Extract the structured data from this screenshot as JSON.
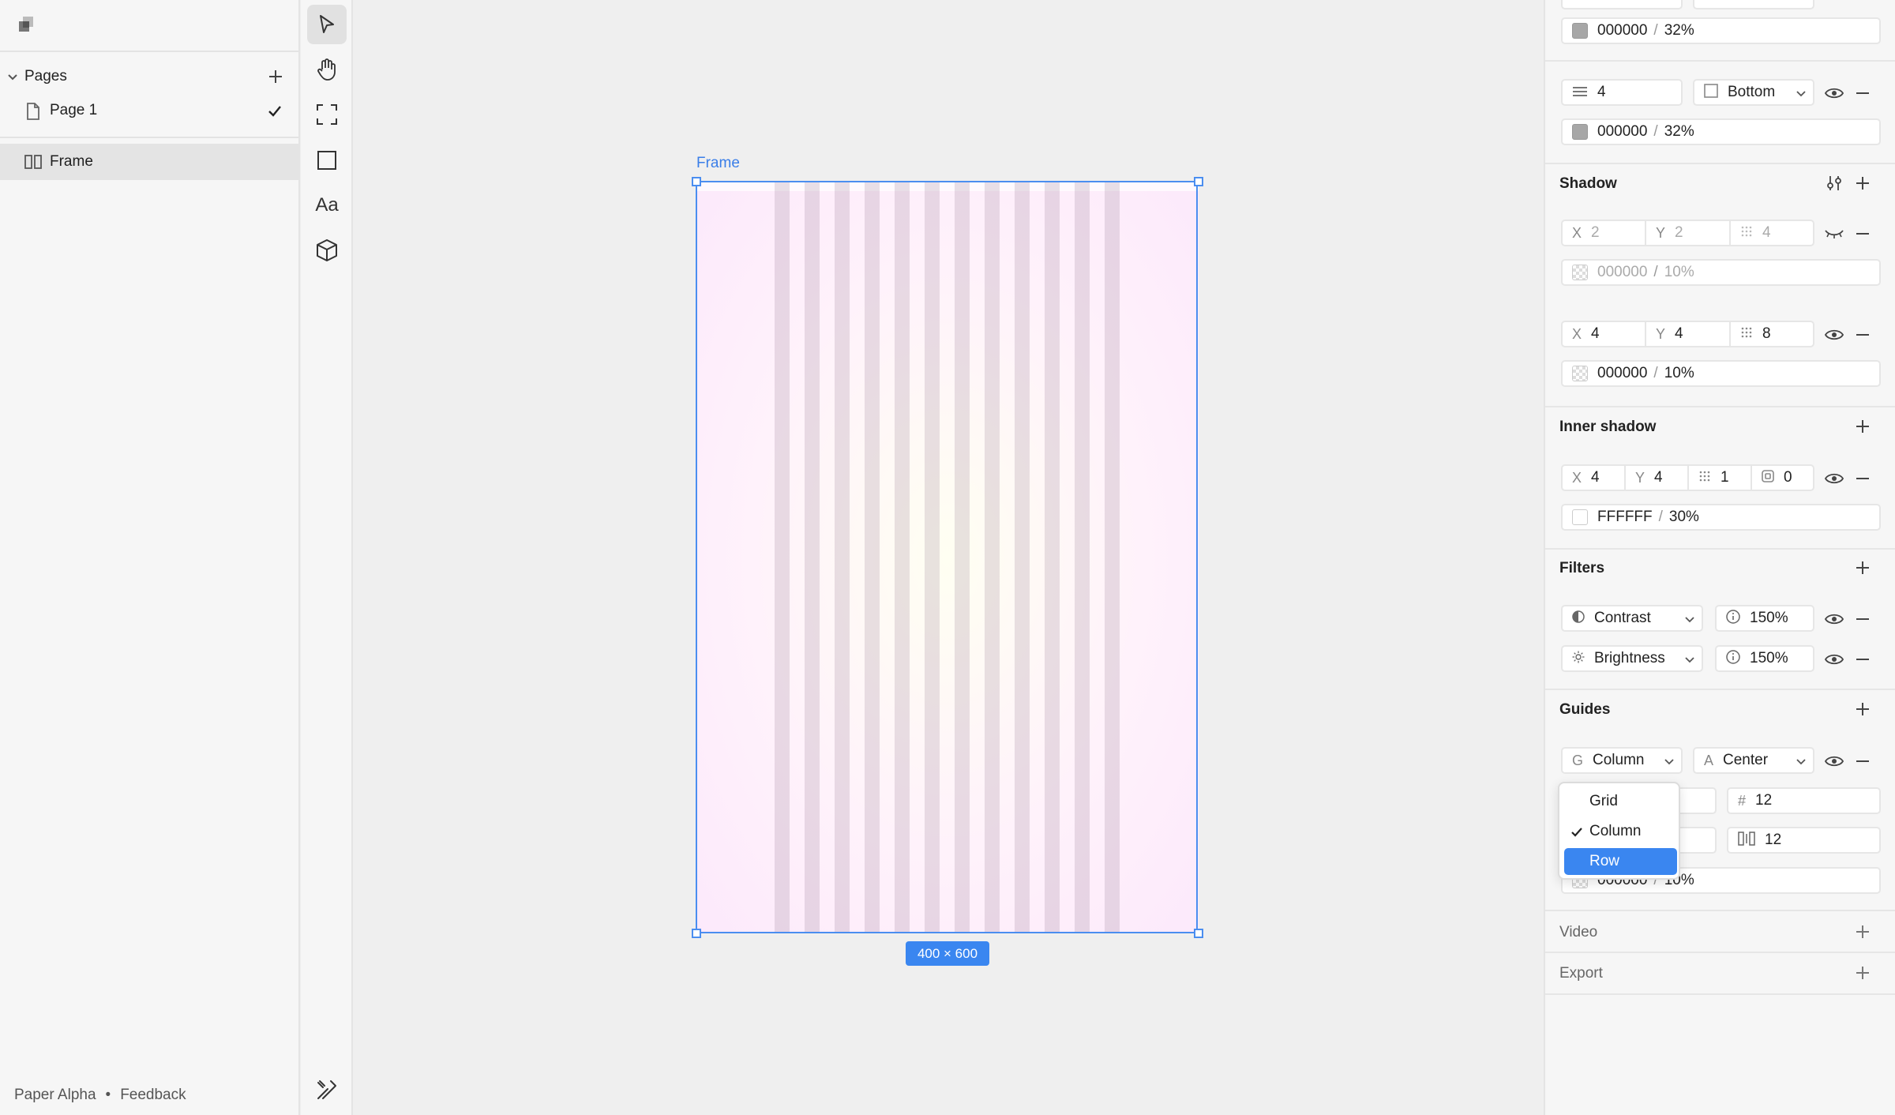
{
  "sidebar": {
    "pages_label": "Pages",
    "pages": [
      {
        "label": "Page 1",
        "selected": true
      }
    ],
    "layers": [
      {
        "label": "Frame"
      }
    ],
    "footer": {
      "app": "Paper Alpha",
      "dot": "•",
      "feedback": "Feedback"
    }
  },
  "toolbar": {
    "tools": [
      "select-tool",
      "hand-tool",
      "frame-tool",
      "rectangle-tool",
      "text-tool",
      "component-tool"
    ],
    "text_tool_label": "Aa"
  },
  "canvas": {
    "frame_label": "Frame",
    "size_badge": "400 × 600"
  },
  "inspector": {
    "borders": [
      {
        "color": "000000",
        "opacity": "32%"
      },
      {
        "width": "4",
        "side": "Bottom",
        "color": "000000",
        "opacity": "32%"
      }
    ],
    "shadow": {
      "title": "Shadow",
      "items": [
        {
          "x": "2",
          "y": "2",
          "blur": "4",
          "color": "000000",
          "opacity": "10%",
          "hidden": true
        },
        {
          "x": "4",
          "y": "4",
          "blur": "8",
          "color": "000000",
          "opacity": "10%",
          "hidden": false
        }
      ]
    },
    "inner_shadow": {
      "title": "Inner shadow",
      "x": "4",
      "y": "4",
      "blur": "1",
      "spread": "0",
      "color": "FFFFFF",
      "opacity": "30%"
    },
    "filters": {
      "title": "Filters",
      "items": [
        {
          "name": "Contrast",
          "value": "150%"
        },
        {
          "name": "Brightness",
          "value": "150%"
        }
      ]
    },
    "guides": {
      "title": "Guides",
      "type": "Column",
      "type_prefix": "G",
      "align": "Center",
      "align_prefix": "A",
      "count_prefix": "#",
      "count": "12",
      "gutter": "12",
      "color": "000000",
      "opacity": "10%",
      "menu": [
        {
          "label": "Grid",
          "checked": false,
          "highlighted": false
        },
        {
          "label": "Column",
          "checked": true,
          "highlighted": false
        },
        {
          "label": "Row",
          "checked": false,
          "highlighted": true
        }
      ]
    },
    "video": {
      "title": "Video"
    },
    "export": {
      "title": "Export"
    },
    "labels": {
      "x": "X",
      "y": "Y",
      "sep": "/"
    }
  }
}
